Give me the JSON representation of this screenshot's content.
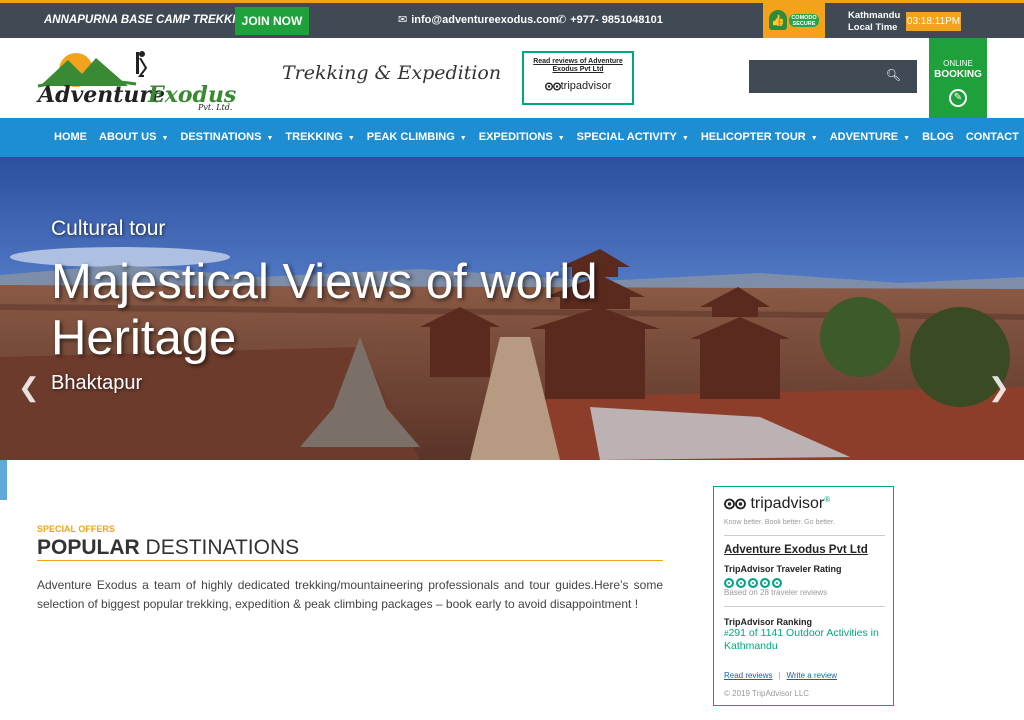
{
  "topbar": {
    "promo": "ANNAPURNA BASE CAMP TREKKING",
    "join_label": "JOIN NOW",
    "email": "info@adventureexodus.com",
    "phone": "+977- 9851048101",
    "comodo_text": "COMODO SECURE",
    "city": "Kathmandu",
    "local_time_label": "Local Time",
    "clock": "03:18:11PM"
  },
  "header": {
    "logo_main": "AdventureExodus",
    "logo_sub": "Pvt. Ltd.",
    "tagline": "Trekking & Expedition",
    "reviews_badge": "Read reviews of Adventure Exodus Pvt Ltd",
    "tripadvisor": "tripadvisor",
    "booking_line1": "ONLINE",
    "booking_line2": "BOOKING"
  },
  "nav": {
    "items": [
      {
        "label": "HOME",
        "dropdown": false
      },
      {
        "label": "ABOUT US",
        "dropdown": true
      },
      {
        "label": "DESTINATIONS",
        "dropdown": true
      },
      {
        "label": "TREKKING",
        "dropdown": true
      },
      {
        "label": "PEAK CLIMBING",
        "dropdown": true
      },
      {
        "label": "EXPEDITIONS",
        "dropdown": true
      },
      {
        "label": "SPECIAL ACTIVITY",
        "dropdown": true
      },
      {
        "label": "HELICOPTER TOUR",
        "dropdown": true
      },
      {
        "label": "ADVENTURE",
        "dropdown": true
      },
      {
        "label": "BLOG",
        "dropdown": false
      },
      {
        "label": "CONTACT",
        "dropdown": false
      }
    ]
  },
  "hero": {
    "subtitle": "Cultural tour",
    "title": "Majestical Views of world Heritage",
    "location": "Bhaktapur"
  },
  "content": {
    "special": "SPECIAL OFFERS",
    "title_bold": "POPULAR",
    "title_rest": " DESTINATIONS",
    "description": "Adventure Exodus a team of highly dedicated trekking/mountaineering professionals and tour guides.Here’s some selection of  biggest popular trekking, expedition & peak climbing packages – book early to avoid disappointment !"
  },
  "widget": {
    "brand": "tripadvisor",
    "brand_mark": "®",
    "sub": "Know better. Book better. Go better.",
    "business": "Adventure Exodus Pvt Ltd",
    "rating_label": "TripAdvisor Traveler Rating",
    "rating": 5,
    "reviews_based": "Based on 28 traveler reviews",
    "ranking_label": "TripAdvisor Ranking",
    "ranking_hash": "#",
    "ranking_text": "291 of 1141 Outdoor Activities in Kathmandu",
    "read_reviews": "Read reviews",
    "write_review": "Write a review",
    "copyright": "© 2019 TripAdvisor LLC"
  },
  "colors": {
    "accent_orange": "#f2a31b",
    "nav_blue": "#1d8ed2",
    "green": "#1ea03a",
    "dark_bar": "#3f4a55",
    "tripadvisor_green": "#00a680"
  }
}
